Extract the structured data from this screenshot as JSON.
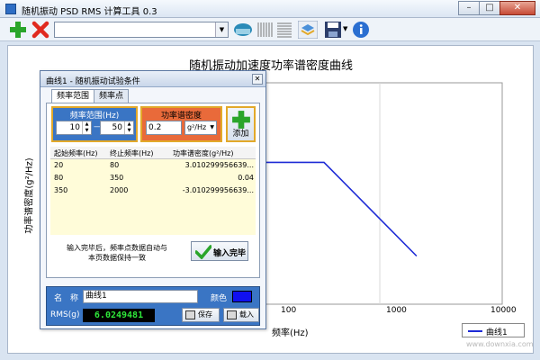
{
  "window": {
    "title": "随机振动 PSD RMS 计算工具 0.3"
  },
  "toolbar": {
    "curve_select_value": ""
  },
  "chart_data": {
    "type": "line",
    "title": "随机振动加速度功率谱密度曲线",
    "xlabel": "频率(Hz)",
    "ylabel": "功率谱密度(g²/Hz)",
    "x_scale": "log",
    "x_ticks": [
      "100",
      "1000",
      "10000"
    ],
    "series": [
      {
        "name": "曲线1",
        "color": "#1e2bd6",
        "x": [
          20,
          80,
          350,
          2000
        ],
        "y": [
          0.01,
          0.04,
          0.04,
          0.0035
        ]
      }
    ],
    "legend_position": "bottom-right",
    "grid": true
  },
  "dialog": {
    "title": "曲线1 - 随机振动试验条件",
    "tabs": [
      "频率范围",
      "频率点"
    ],
    "active_tab": 0,
    "range": {
      "header": "频率范围(Hz)",
      "start": "10",
      "end": "50",
      "dash": "—"
    },
    "psd": {
      "header": "功率谱密度",
      "value": "0.2",
      "unit": "g²/Hz"
    },
    "add_label": "添加",
    "table": {
      "headers": [
        "起始频率(Hz)",
        "终止频率(Hz)",
        "功率谱密度(g²/Hz)"
      ],
      "rows": [
        [
          "20",
          "80",
          "3.010299956639..."
        ],
        [
          "80",
          "350",
          "0.04"
        ],
        [
          "350",
          "2000",
          "-3.010299956639..."
        ]
      ]
    },
    "note_line1": "输入完毕后，频率点数据自动与",
    "note_line2": "本页数据保持一致",
    "done_label": "输入完毕",
    "name_label": "名　称",
    "name_value": "曲线1",
    "color_label": "颜色",
    "color_value": "#1010f0",
    "rms_label": "RMS(g)",
    "rms_value": "6.0249481",
    "save_label": "保存",
    "load_label": "载入"
  },
  "watermark": "www.downxia.com"
}
